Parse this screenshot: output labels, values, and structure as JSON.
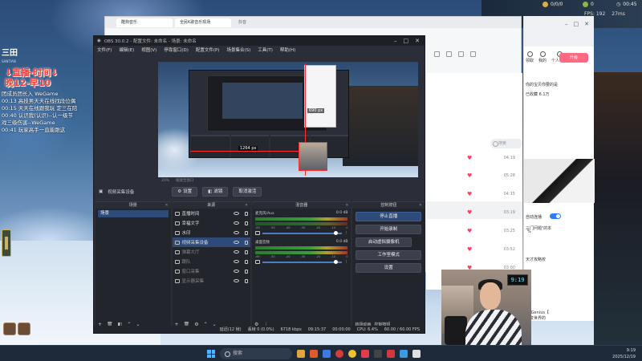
{
  "hud": {
    "kda": "0/0/0",
    "cs": "0",
    "time": "00:45",
    "fps_label": "FPS:",
    "fps_value": "192",
    "ping": "27ms"
  },
  "stream": {
    "logo": "三田",
    "logo_sub": "SANTIAN",
    "title_line1": "↓直播·时间↓",
    "title_line2": "晚12-早10",
    "chat": [
      "团成员团长入 WeGame",
      "00:13 高技男天天在线找段位偶",
      "00:15 天天在线跟我玩 定三在陪",
      "00:40 认识我(认识)--认一级节",
      "戏三级伤害--WeGame",
      "00:41 玩家高手一直能跟这"
    ]
  },
  "browser": {
    "tabs": [
      "酷狗音乐",
      "全民K歌音乐现场",
      "抖音"
    ],
    "search_placeholder": "搜索",
    "col_like": "喜欢",
    "col_duration": "时长",
    "song_durations": [
      "04:19",
      "05:28",
      "04:15",
      "03:19",
      "03:25",
      "03:52",
      "03:00"
    ]
  },
  "obs": {
    "title": "OBS 30.0.2 - 配置文件: 未命名 - 场景: 未命名",
    "menu": [
      "文件(F)",
      "编辑(E)",
      "视图(V)",
      "停靠窗口(D)",
      "配置文件(P)",
      "场景集合(S)",
      "工具(T)",
      "帮助(H)"
    ],
    "preview_labels": {
      "width": "1264 px",
      "height": "690 px"
    },
    "under_preview": [
      "20%",
      "缩放至窗口"
    ],
    "source_bar": {
      "label": "视频采集设备",
      "btn_settings": "设置",
      "btn_filters": "滤镜",
      "btn_deactivate": "取消激活"
    },
    "docks": {
      "scenes": {
        "title": "场景",
        "items": [
          "场景"
        ]
      },
      "sources": {
        "title": "来源",
        "items": [
          "直播时间",
          "幸福文字",
          "水印",
          "视频采集设备",
          "弹幕大厅",
          "跟队",
          "窗口采集",
          "显示器采集"
        ]
      },
      "mixer": {
        "title": "混音器",
        "channels": [
          {
            "name": "麦克风/Aux",
            "db": "0.0 dB"
          },
          {
            "name": "桌面音频",
            "db": "0.0 dB"
          }
        ],
        "ticks": [
          "-60",
          "-55",
          "-50",
          "-45",
          "-40",
          "-35",
          "-30",
          "-25",
          "-20",
          "-15",
          "-10",
          "-5",
          "0"
        ]
      },
      "controls": {
        "title": "控制按钮",
        "buttons": [
          "停止直播",
          "开始录制",
          "启动虚拟摄像机",
          "工作室模式",
          "设置"
        ],
        "tabs": [
          "转场动画",
          "控制按钮"
        ]
      }
    },
    "status": {
      "frames": "延迟(12 帧)",
      "dropped": "丢帧 0 (0.0%)",
      "bitrate": "6718 kbps",
      "stream_time": "09:15:37",
      "rec_time": "00:00:00",
      "cpu": "CPU: 6.4%",
      "fps": "60.00 / 60.00 FPS"
    }
  },
  "rpanel": {
    "nav": [
      "领取",
      "我的",
      "个人中心"
    ],
    "btn_upgrade": "升级",
    "text_title": "你的宝贝你要的是",
    "text_count": "已收藏 6.1万",
    "toggle_label": "自动连播",
    "text_song": "三门问题\"的本",
    "text_percent": "%",
    "text_lines": [
      "天才攻略校",
      "才/Genius【",
      "改变世界的"
    ]
  },
  "webcam": {
    "clock": "9:19"
  },
  "taskbar": {
    "search_placeholder": "搜索",
    "tray_time": "9:19",
    "tray_date": "2025/12/19"
  }
}
